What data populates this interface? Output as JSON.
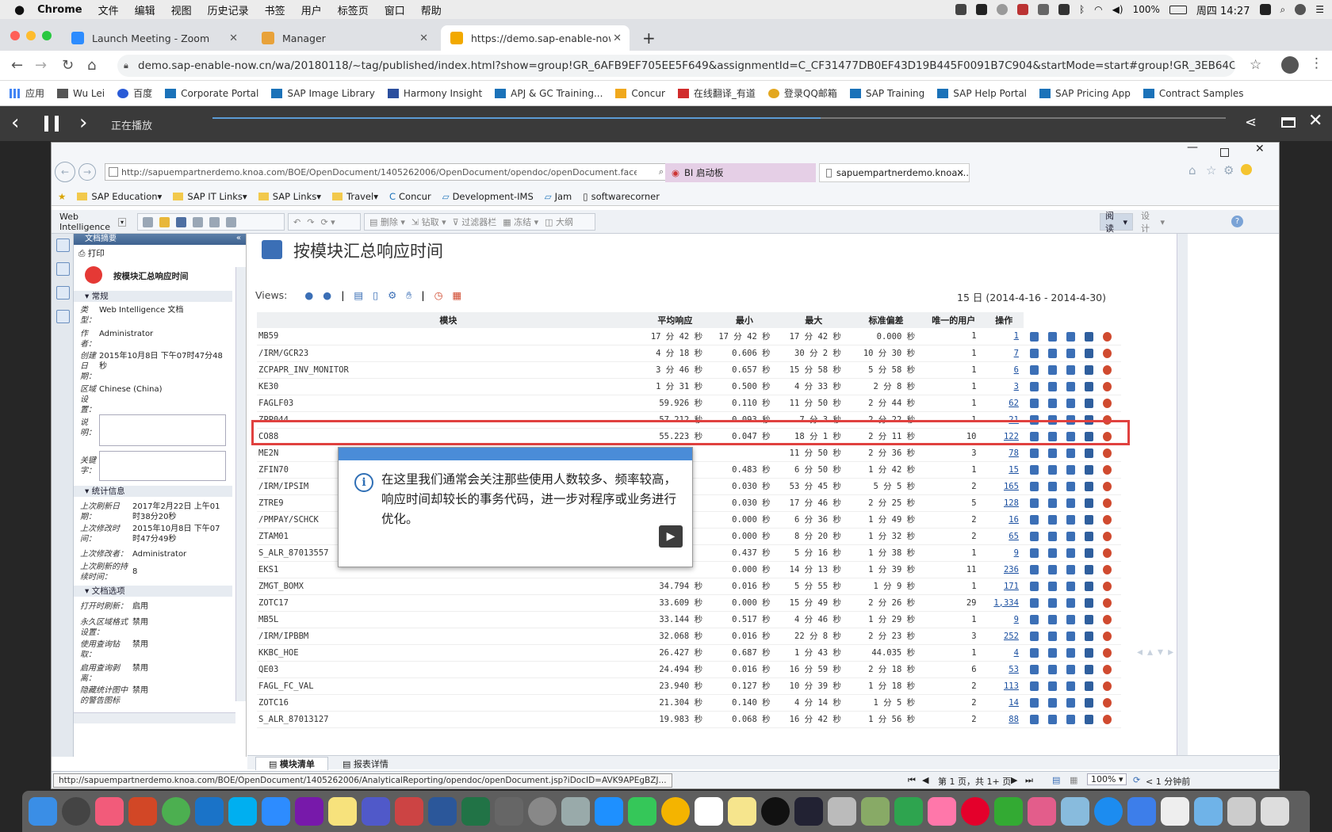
{
  "mac_menubar": {
    "app": "Chrome",
    "menus": [
      "文件",
      "编辑",
      "视图",
      "历史记录",
      "书签",
      "用户",
      "标签页",
      "窗口",
      "帮助"
    ],
    "battery": "100%",
    "clock": "周四 14:27"
  },
  "browser": {
    "tabs": [
      {
        "label": "Launch Meeting - Zoom",
        "color": "#2d8cff"
      },
      {
        "label": "Manager",
        "color": "#e8a23a"
      },
      {
        "label": "https://demo.sap-enable-now.c",
        "color": "#f2a900"
      }
    ],
    "url": "demo.sap-enable-now.cn/wa/20180118/~tag/published/index.html?show=group!GR_6AFB9EF705EE5F649&assignmentId=C_CF31477DB0EF43D19B445F0091B7C904&startMode=start#group!GR_3EB64CE4B90ECC8D",
    "bookmarks": [
      "应用",
      "Wu Lei",
      "百度",
      "Corporate Portal",
      "SAP Image Library",
      "Harmony Insight",
      "APJ & GC Training...",
      "Concur",
      "在线翻译_有道",
      "登录QQ邮箱",
      "SAP Training",
      "SAP Help Portal",
      "SAP Pricing App",
      "Contract Samples"
    ]
  },
  "player": {
    "status": "正在播放",
    "progress": 0.6
  },
  "ie": {
    "address": "http://sapuempartnerdemo.knoa.com/BOE/OpenDocument/1405262006/OpenDocument/opendoc/openDocument.faces",
    "tabs": [
      "BI 启动板",
      "sapuempartnerdemo.knoa...."
    ],
    "favorites": [
      "SAP Education",
      "SAP IT Links",
      "SAP Links",
      "Travel",
      "Concur",
      "Development-IMS",
      "Jam",
      "softwarecorner"
    ]
  },
  "toolbar": {
    "app": "Web Intelligence",
    "group1": [
      "删除",
      "钻取",
      "过滤器栏",
      "冻结",
      "大纲"
    ],
    "read": "阅读",
    "design": "设计"
  },
  "docpanel": {
    "header": "文档摘要",
    "print": "打印",
    "docname": "按模块汇总响应时间",
    "sec_general": "常规",
    "type_label": "类型：",
    "type_value": "Web Intelligence 文档",
    "author_label": "作者：",
    "author_value": "Administrator",
    "created_label": "创建日期：",
    "created_value": "2015年10月8日 下午07时47分48秒",
    "locale_label": "区域设置：",
    "locale_value": "Chinese (China)",
    "desc_label": "说明：",
    "kw_label": "关键字：",
    "sec_stats": "统计信息",
    "refresh_label": "上次刷新日期：",
    "refresh_value": "2017年2月22日 上午01时38分20秒",
    "modified_label": "上次修改时间：",
    "modified_value": "2015年10月8日 下午07时47分49秒",
    "modby_label": "上次修改者：",
    "modby_value": "Administrator",
    "dur_label": "上次刷新的持续时间：",
    "dur_value": "8",
    "sec_options": "文档选项",
    "opt1_label": "打开时刷新：",
    "opt1_value": "启用",
    "opt2_label": "永久区域格式设置：",
    "opt2_value": "禁用",
    "opt3_label": "使用查询钻取：",
    "opt3_value": "禁用",
    "opt4_label": "启用查询剥离：",
    "opt4_value": "禁用",
    "opt5_label": "隐藏统计图中的警告图标",
    "opt5_value": "禁用"
  },
  "report": {
    "title": "按模块汇总响应时间",
    "views_label": "Views:",
    "date_range": "15 日 (2014-4-16 - 2014-4-30)",
    "columns": [
      "模块",
      "平均响应",
      "最小",
      "最大",
      "标准偏差",
      "唯一的用户",
      "操作"
    ],
    "rows": [
      [
        "MB59",
        "17 分 42 秒",
        "17 分 42 秒",
        "17 分 42 秒",
        "0.000 秒",
        "1",
        "1"
      ],
      [
        "/IRM/GCR23",
        "4 分 18 秒",
        "0.606 秒",
        "30 分 2 秒",
        "10 分 30 秒",
        "1",
        "7"
      ],
      [
        "ZCPAPR_INV_MONITOR",
        "3 分 46 秒",
        "0.657 秒",
        "15 分 58 秒",
        "5 分 58 秒",
        "1",
        "6"
      ],
      [
        "KE30",
        "1 分 31 秒",
        "0.500 秒",
        "4 分 33 秒",
        "2 分 8 秒",
        "1",
        "3"
      ],
      [
        "FAGLF03",
        "59.926 秒",
        "0.110 秒",
        "11 分 50 秒",
        "2 分 44 秒",
        "1",
        "62"
      ],
      [
        "ZPP044",
        "57.212 秒",
        "0.093 秒",
        "7 分 3 秒",
        "2 分 22 秒",
        "1",
        "21"
      ],
      [
        "CO88",
        "55.223 秒",
        "0.047 秒",
        "18 分 1 秒",
        "2 分 11 秒",
        "10",
        "122"
      ],
      [
        "ME2N",
        "",
        "",
        "11 分 50 秒",
        "2 分 36 秒",
        "3",
        "78"
      ],
      [
        "ZFIN70",
        "",
        "0.483 秒",
        "6 分 50 秒",
        "1 分 42 秒",
        "1",
        "15"
      ],
      [
        "/IRM/IPSIM",
        "",
        "0.030 秒",
        "53 分 45 秒",
        "5 分 5 秒",
        "2",
        "165"
      ],
      [
        "ZTRE9",
        "",
        "0.030 秒",
        "17 分 46 秒",
        "2 分 25 秒",
        "5",
        "128"
      ],
      [
        "/PMPAY/SCHCK",
        "",
        "0.000 秒",
        "6 分 36 秒",
        "1 分 49 秒",
        "2",
        "16"
      ],
      [
        "ZTAM01",
        "",
        "0.000 秒",
        "8 分 20 秒",
        "1 分 32 秒",
        "2",
        "65"
      ],
      [
        "S_ALR_87013557",
        "",
        "0.437 秒",
        "5 分 16 秒",
        "1 分 38 秒",
        "1",
        "9"
      ],
      [
        "EKS1",
        "",
        "0.000 秒",
        "14 分 13 秒",
        "1 分 39 秒",
        "11",
        "236"
      ],
      [
        "ZMGT_BOMX",
        "34.794 秒",
        "0.016 秒",
        "5 分 55 秒",
        "1 分 9 秒",
        "1",
        "171"
      ],
      [
        "ZOTC17",
        "33.609 秒",
        "0.000 秒",
        "15 分 49 秒",
        "2 分 26 秒",
        "29",
        "1,334"
      ],
      [
        "MB5L",
        "33.144 秒",
        "0.517 秒",
        "4 分 46 秒",
        "1 分 29 秒",
        "1",
        "9"
      ],
      [
        "/IRM/IPBBM",
        "32.068 秒",
        "0.016 秒",
        "22 分 8 秒",
        "2 分 23 秒",
        "3",
        "252"
      ],
      [
        "KKBC_HOE",
        "26.427 秒",
        "0.687 秒",
        "1 分 43 秒",
        "44.035 秒",
        "1",
        "4"
      ],
      [
        "QE03",
        "24.494 秒",
        "0.016 秒",
        "16 分 59 秒",
        "2 分 18 秒",
        "6",
        "53"
      ],
      [
        "FAGL_FC_VAL",
        "23.940 秒",
        "0.127 秒",
        "10 分 39 秒",
        "1 分 18 秒",
        "2",
        "113"
      ],
      [
        "ZOTC16",
        "21.304 秒",
        "0.140 秒",
        "4 分 14 秒",
        "1 分 5 秒",
        "2",
        "14"
      ],
      [
        "S_ALR_87013127",
        "19.983 秒",
        "0.068 秒",
        "16 分 42 秒",
        "1 分 56 秒",
        "2",
        "88"
      ]
    ]
  },
  "callout": {
    "text": "在这里我们通常会关注那些使用人数较多、频率较高，响应时间却较长的事务代码，进一步对程序或业务进行优化。"
  },
  "bottom": {
    "tab1": "模块清单",
    "tab2": "报表详情",
    "status_url": "http://sapuempartnerdemo.knoa.com/BOE/OpenDocument/1405262006/AnalyticalReporting/opendoc/openDocument.jsp?iDocID=AVK9APEgBZJ...",
    "page": "第 1 页，共 1+ 页",
    "zoom": "100%",
    "time": "< 1 分钟前"
  }
}
